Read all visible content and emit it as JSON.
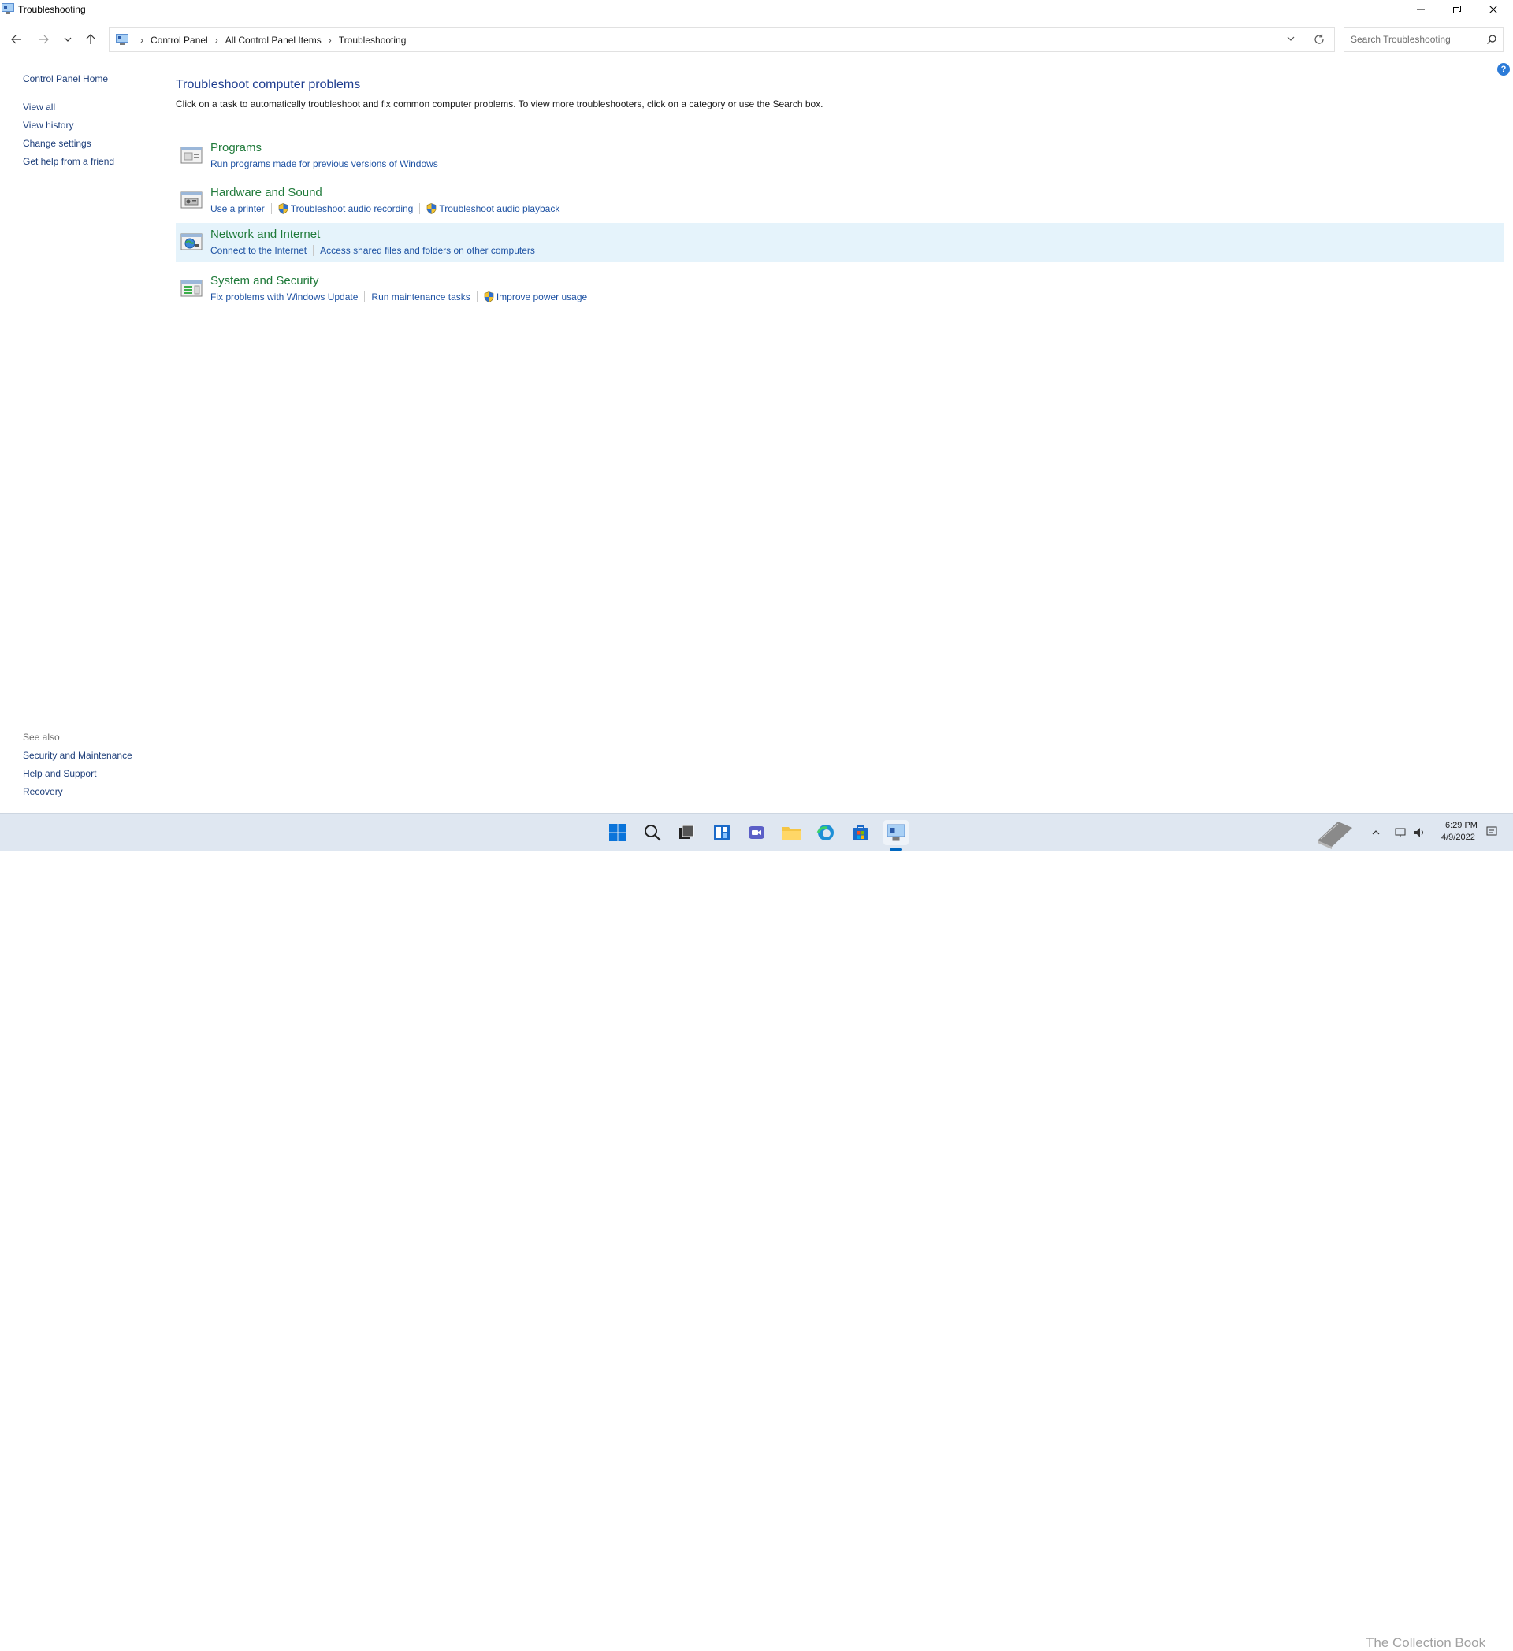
{
  "window": {
    "title": "Troubleshooting",
    "icon": "control-panel-icon"
  },
  "address": {
    "crumbs": [
      "Control Panel",
      "All Control Panel Items",
      "Troubleshooting"
    ]
  },
  "search": {
    "placeholder": "Search Troubleshooting"
  },
  "sidebar": {
    "home": "Control Panel Home",
    "links": [
      "View all",
      "View history",
      "Change settings",
      "Get help from a friend"
    ],
    "see_also_label": "See also",
    "see_also": [
      "Security and Maintenance",
      "Help and Support",
      "Recovery"
    ]
  },
  "main": {
    "title": "Troubleshoot computer problems",
    "description": "Click on a task to automatically troubleshoot and fix common computer problems. To view more troubleshooters, click on a category or use the Search box.",
    "categories": [
      {
        "title": "Programs",
        "tasks": [
          {
            "label": "Run programs made for previous versions of Windows",
            "shield": false
          }
        ]
      },
      {
        "title": "Hardware and Sound",
        "tasks": [
          {
            "label": "Use a printer",
            "shield": false
          },
          {
            "label": "Troubleshoot audio recording",
            "shield": true
          },
          {
            "label": "Troubleshoot audio playback",
            "shield": true
          }
        ]
      },
      {
        "title": "Network and Internet",
        "tasks": [
          {
            "label": "Connect to the Internet",
            "shield": false
          },
          {
            "label": "Access shared files and folders on other computers",
            "shield": false
          }
        ]
      },
      {
        "title": "System and Security",
        "tasks": [
          {
            "label": "Fix problems with Windows Update",
            "shield": false
          },
          {
            "label": "Run maintenance tasks",
            "shield": false
          },
          {
            "label": "Improve power usage",
            "shield": true
          }
        ]
      }
    ]
  },
  "taskbar": {
    "time": "6:29 PM",
    "date": "4/9/2022",
    "watermark": "The Collection Book"
  },
  "colors": {
    "link": "#1e52a3",
    "category": "#1f7a3a",
    "title": "#1e3d8f",
    "highlight": "#e5f3fb",
    "taskbar": "#dfe7f1"
  }
}
